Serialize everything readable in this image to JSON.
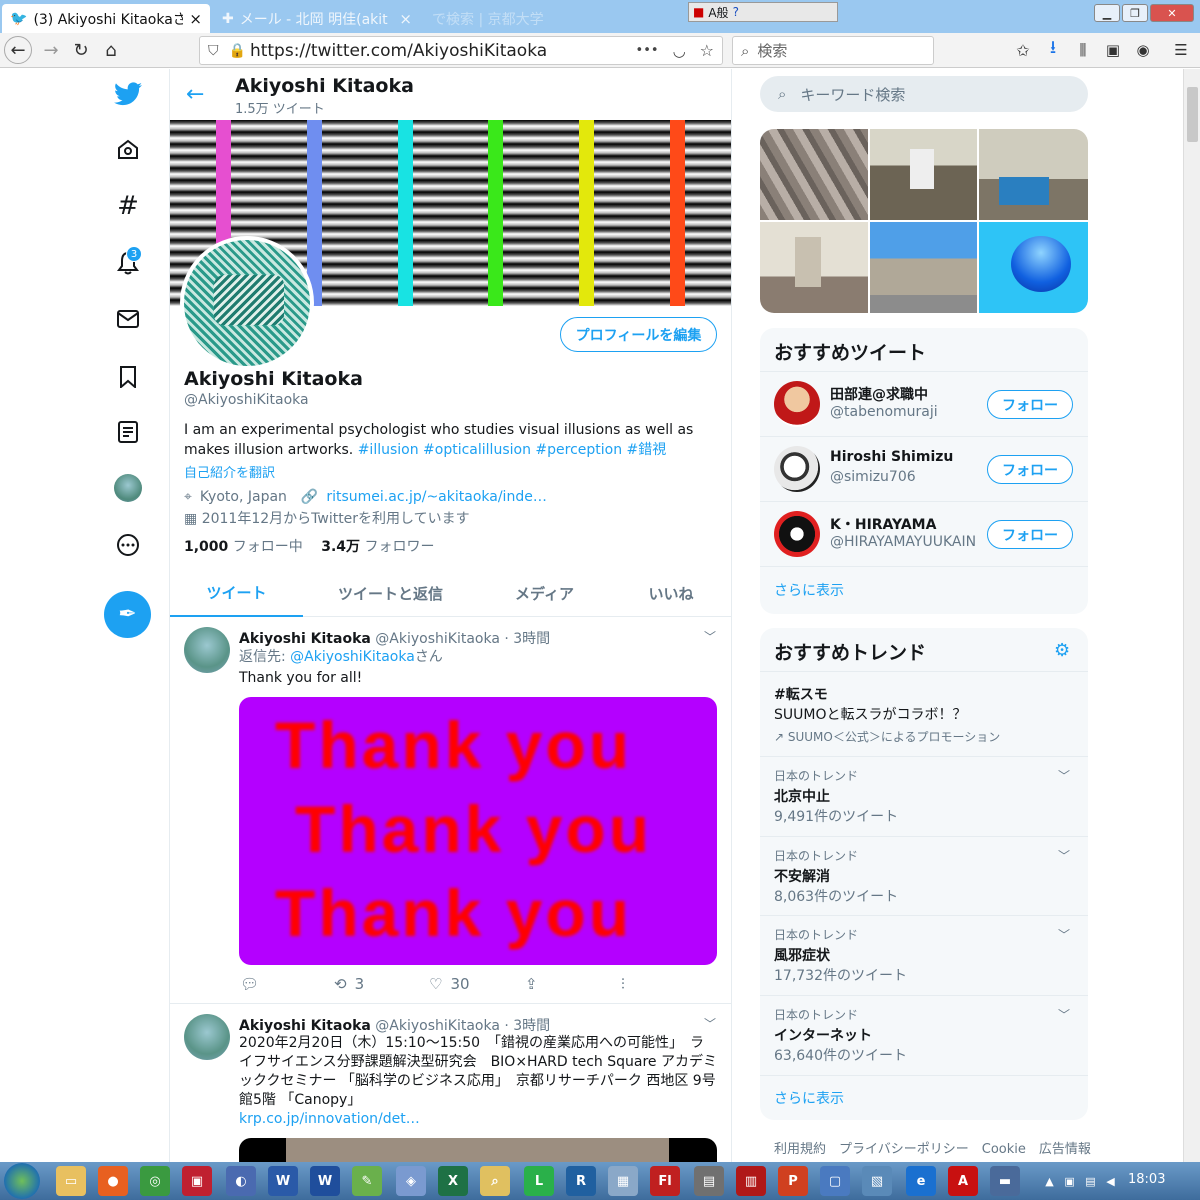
{
  "browser": {
    "tabs": [
      {
        "title": "(3) Akiyoshi Kitaokaさん",
        "close": "×"
      },
      {
        "title": "メール - 北岡 明佳(akit",
        "close": "×"
      },
      {
        "title": "で検索 | 京都大学",
        "close": ""
      }
    ],
    "url": "https://twitter.com/AkiyoshiKitaoka",
    "url_more": "•••",
    "search_placeholder": "検索",
    "ime_label": "A般"
  },
  "sidebar": {
    "notification_count": "3"
  },
  "header": {
    "name": "Akiyoshi Kitaoka",
    "tweet_count": "1.5万 ツイート"
  },
  "banner_colors": [
    "#e64fd0",
    "#6f8ef0",
    "#18e3e3",
    "#3ae81a",
    "#e3e80c",
    "#ff4a18"
  ],
  "profile": {
    "edit_button": "プロフィールを編集",
    "name": "Akiyoshi Kitaoka",
    "handle": "@AkiyoshiKitaoka",
    "bio": "I am an experimental psychologist who studies visual illusions as well as makes illusion artworks. ",
    "hashtags": "#illusion #opticalillusion #perception #錯視",
    "translate": "自己紹介を翻訳",
    "location": "Kyoto, Japan",
    "website": "ritsumei.ac.jp/~akitaoka/inde…",
    "joined": "2011年12月からTwitterを利用しています",
    "following_count": "1,000",
    "following_label": "フォロー中",
    "followers_count": "3.4万",
    "followers_label": "フォロワー"
  },
  "tabs": [
    "ツイート",
    "ツイートと返信",
    "メディア",
    "いいね"
  ],
  "tweets": [
    {
      "name": "Akiyoshi Kitaoka",
      "handle": "@AkiyoshiKitaoka",
      "time": "· 3時間",
      "reply_prefix": "返信先: ",
      "reply_to": "@AkiyoshiKitaoka",
      "reply_suffix": "さん",
      "text": "Thank you for all!",
      "image_lines": [
        "Thank you",
        "Thank you",
        "Thank you"
      ],
      "retweets": "3",
      "likes": "30"
    },
    {
      "name": "Akiyoshi Kitaoka",
      "handle": "@AkiyoshiKitaoka",
      "time": "· 3時間",
      "text": "2020年2月20日（木）15:10～15:50　「錯視の産業応用への可能性」　ライフサイエンス分野課題解決型研究会　BIO×HARD tech Square アカデミッククセミナー 「脳科学のビジネス応用」　京都リサーチパーク 西地区 9号館5階 「Canopy」",
      "link": "krp.co.jp/innovation/det…"
    }
  ],
  "right": {
    "search_placeholder": "キーワード検索",
    "who_to_follow_title": "おすすめツイート",
    "recommendations": [
      {
        "name": "田部連@求職中",
        "handle": "@tabenomuraji",
        "button": "フォロー"
      },
      {
        "name": "Hiroshi Shimizu",
        "handle": "@simizu706",
        "button": "フォロー"
      },
      {
        "name": "K・HIRAYAMA",
        "handle": "@HIRAYAMAYUUKAIN",
        "button": "フォロー"
      }
    ],
    "show_more": "さらに表示",
    "trends_title": "おすすめトレンド",
    "promoted": {
      "name": "#転スモ",
      "desc": "SUUMOと転スラがコラボ！？",
      "by": "SUUMO＜公式＞によるプロモーション"
    },
    "trends": [
      {
        "category": "日本のトレンド",
        "name": "北京中止",
        "count": "9,491件のツイート"
      },
      {
        "category": "日本のトレンド",
        "name": "不安解消",
        "count": "8,063件のツイート"
      },
      {
        "category": "日本のトレンド",
        "name": "風邪症状",
        "count": "17,732件のツイート"
      },
      {
        "category": "日本のトレンド",
        "name": "インターネット",
        "count": "63,640件のツイート"
      }
    ],
    "trends_more": "さらに表示",
    "footer": "利用規約　プライバシーポリシー　Cookie　広告情報"
  },
  "taskbar": {
    "clock": "18:03"
  }
}
